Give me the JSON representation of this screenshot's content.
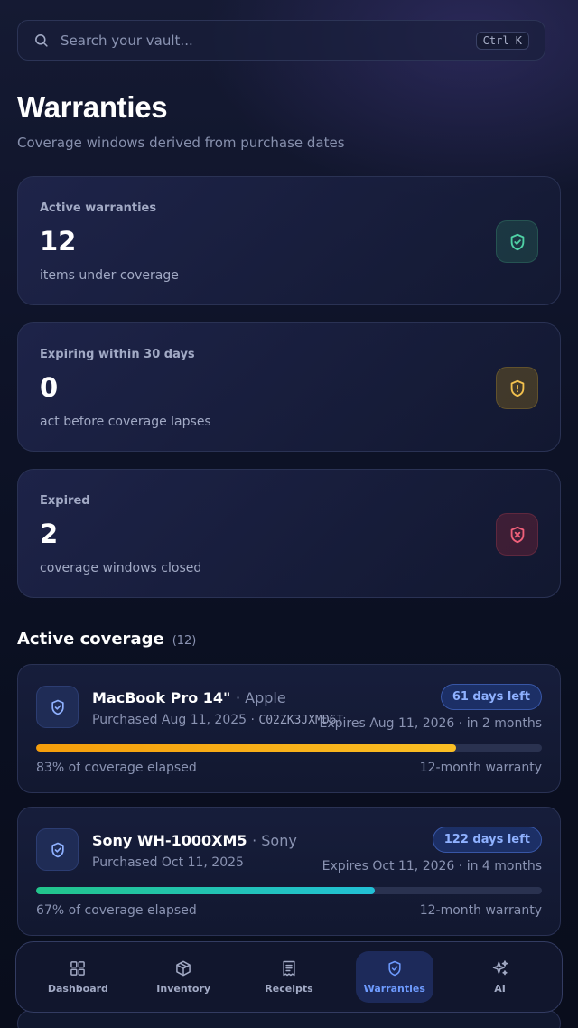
{
  "search": {
    "placeholder": "Search your vault...",
    "shortcut": "Ctrl K"
  },
  "header": {
    "title": "Warranties",
    "subtitle": "Coverage windows derived from purchase dates"
  },
  "stats": [
    {
      "label": "Active warranties",
      "value": "12",
      "hint": "items under coverage",
      "icon": "shield-check-icon",
      "color": "#4fd1a5"
    },
    {
      "label": "Expiring within 30 days",
      "value": "0",
      "hint": "act before coverage lapses",
      "icon": "shield-alert-icon",
      "color": "#f2c14e"
    },
    {
      "label": "Expired",
      "value": "2",
      "hint": "coverage windows closed",
      "icon": "shield-x-icon",
      "color": "#f0607a"
    }
  ],
  "coverage": {
    "title": "Active coverage",
    "count": "(12)",
    "items": [
      {
        "name": "MacBook Pro 14\"",
        "brand": "· Apple",
        "purchased": "Purchased Aug 11, 2025 · ",
        "serial": "C02ZK3JXMD6T",
        "days_left": "61 days left",
        "expires": "Expires Aug 11, 2026 · in 2 months",
        "elapsed_label": "83% of coverage elapsed",
        "elapsed_fraction": 0.83,
        "term": "12-month warranty",
        "bar_colors": [
          "#f59e0b",
          "#fbbf24"
        ]
      },
      {
        "name": "Sony WH-1000XM5",
        "brand": "· Sony",
        "purchased": "Purchased Oct 11, 2025",
        "serial": "",
        "days_left": "122 days left",
        "expires": "Expires Oct 11, 2026 · in 4 months",
        "elapsed_label": "67% of coverage elapsed",
        "elapsed_fraction": 0.67,
        "term": "12-month warranty",
        "bar_colors": [
          "#22c58b",
          "#22c1d6"
        ]
      }
    ]
  },
  "nav": {
    "items": [
      {
        "label": "Dashboard",
        "icon": "grid-icon"
      },
      {
        "label": "Inventory",
        "icon": "box-icon"
      },
      {
        "label": "Receipts",
        "icon": "receipt-icon"
      },
      {
        "label": "Warranties",
        "icon": "shield-icon",
        "active": true
      },
      {
        "label": "AI",
        "icon": "sparkles-icon"
      }
    ]
  }
}
